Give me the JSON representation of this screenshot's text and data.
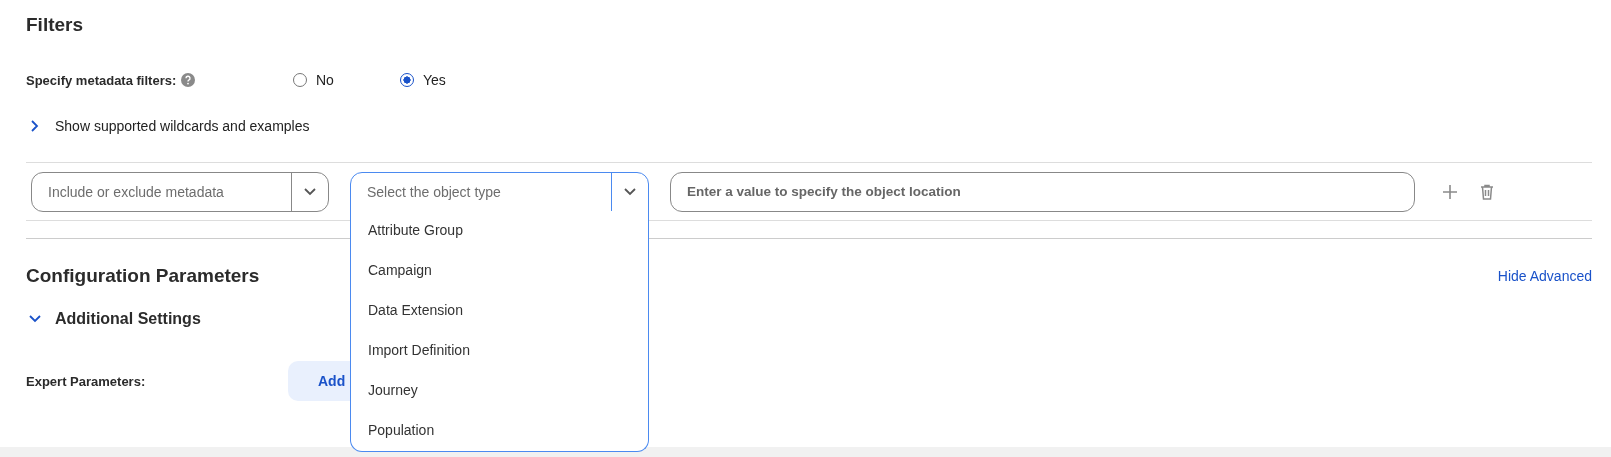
{
  "filters": {
    "title": "Filters",
    "specify_label": "Specify metadata filters:",
    "radios": [
      {
        "label": "No",
        "selected": false
      },
      {
        "label": "Yes",
        "selected": true
      }
    ],
    "wildcards_toggle": {
      "label": "Show supported wildcards and examples",
      "expanded": false
    },
    "row": {
      "include_select": {
        "placeholder": "Include or exclude metadata"
      },
      "type_select": {
        "placeholder": "Select the object type",
        "expanded": true,
        "options": [
          "Attribute Group",
          "Campaign",
          "Data Extension",
          "Import Definition",
          "Journey",
          "Population"
        ]
      },
      "location_field": {
        "placeholder": "Enter a value to specify the object location"
      }
    }
  },
  "configuration": {
    "title": "Configuration Parameters",
    "hide_advanced": "Hide Advanced",
    "additional_settings": {
      "label": "Additional Settings",
      "expanded": true
    },
    "expert_label": "Expert Parameters:",
    "add_button": "Add"
  }
}
